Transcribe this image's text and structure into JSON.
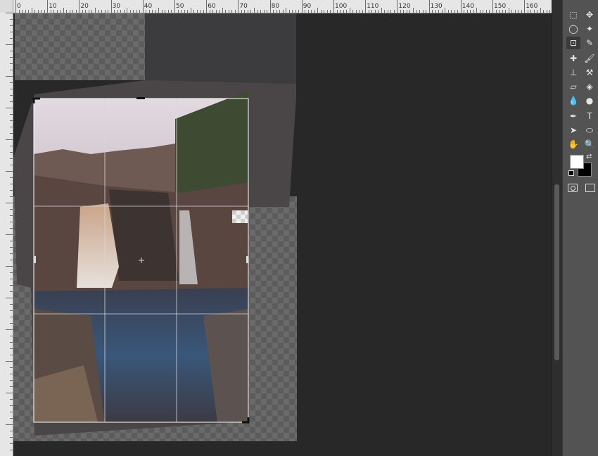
{
  "ruler": {
    "labels": [
      "0",
      "10",
      "20",
      "30",
      "40",
      "50",
      "60",
      "70",
      "80",
      "90",
      "100",
      "110",
      "120",
      "130",
      "140",
      "150",
      "160"
    ]
  },
  "crop": {
    "grid": "rule-of-thirds",
    "transparent_patch": true
  },
  "toolbar": {
    "tools": [
      {
        "name": "marquee-tool-icon",
        "glyph": "⬚"
      },
      {
        "name": "move-tool-icon",
        "glyph": "✥"
      },
      {
        "name": "lasso-tool-icon",
        "glyph": "◯"
      },
      {
        "name": "magic-wand-tool-icon",
        "glyph": "✦"
      },
      {
        "name": "crop-tool-icon",
        "glyph": "⊡",
        "active": true
      },
      {
        "name": "eyedropper-tool-icon",
        "glyph": "✎"
      },
      {
        "name": "healing-brush-tool-icon",
        "glyph": "✚"
      },
      {
        "name": "brush-tool-icon",
        "glyph": "🖌"
      },
      {
        "name": "clone-stamp-tool-icon",
        "glyph": "⊥"
      },
      {
        "name": "history-brush-tool-icon",
        "glyph": "⚒"
      },
      {
        "name": "eraser-tool-icon",
        "glyph": "▱"
      },
      {
        "name": "paint-bucket-tool-icon",
        "glyph": "◈"
      },
      {
        "name": "blur-tool-icon",
        "glyph": "💧"
      },
      {
        "name": "dodge-tool-icon",
        "glyph": "●"
      },
      {
        "name": "pen-tool-icon",
        "glyph": "✒"
      },
      {
        "name": "type-tool-icon",
        "glyph": "T"
      },
      {
        "name": "path-selection-tool-icon",
        "glyph": "➤"
      },
      {
        "name": "ellipse-tool-icon",
        "glyph": "⬭"
      },
      {
        "name": "hand-tool-icon",
        "glyph": "✋"
      },
      {
        "name": "zoom-tool-icon",
        "glyph": "🔍"
      }
    ],
    "foreground_color": "#ffffff",
    "background_color": "#000000"
  }
}
